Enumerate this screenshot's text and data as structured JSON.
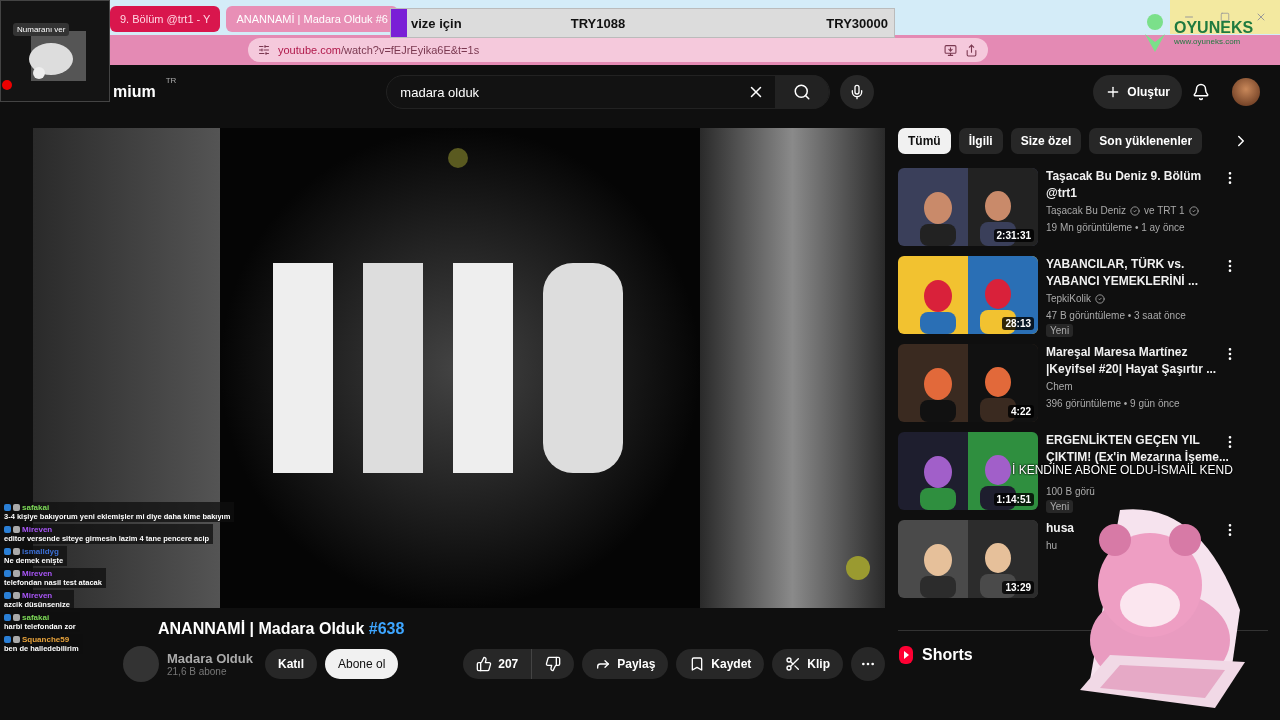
{
  "browser": {
    "tabs": [
      {
        "title": "9. Bölüm @trt1 - Y",
        "selected": false
      },
      {
        "title": "ANANNAMİ | Madara Olduk #6",
        "selected": true
      }
    ],
    "url_domain": "youtube.com",
    "url_path": "/watch?v=fEJrEyika6E&t=1s"
  },
  "header": {
    "logo_text": "mium",
    "region": "TR",
    "search": "madara olduk",
    "create": "Oluştur"
  },
  "video": {
    "title": "ANANNAMİ | Madara Olduk",
    "hashtag": "#638",
    "channel": "Madara Olduk",
    "subscribers": "21,6 B abone",
    "join": "Katıl",
    "subscribe": "Abone ol",
    "likes": "207",
    "share": "Paylaş",
    "save": "Kaydet",
    "clip": "Klip"
  },
  "chips": [
    {
      "label": "Tümü",
      "selected": true
    },
    {
      "label": "İlgili",
      "selected": false
    },
    {
      "label": "Size özel",
      "selected": false
    },
    {
      "label": "Son yüklenenler",
      "selected": false
    }
  ],
  "related": [
    {
      "title": [
        "Taşacak Bu Deniz 9. Bölüm",
        "@trt1"
      ],
      "channels": [
        {
          "name": "Taşacak Bu Deniz",
          "verified": true
        },
        {
          "name": "ve TRT 1",
          "verified": true
        }
      ],
      "meta": "19 Mn görüntüleme • 1 ay önce",
      "duration": "2:31:31"
    },
    {
      "title": [
        "YABANCILAR, TÜRK vs.",
        "YABANCI YEMEKLERİNİ ..."
      ],
      "channels": [
        {
          "name": "TepkiKolik",
          "verified": true
        }
      ],
      "meta": "47 B görüntüleme • 3 saat önce",
      "duration": "28:13",
      "badge": "Yeni"
    },
    {
      "title": [
        "Mareşal Maresa Martínez",
        "|Keyifsel #20| Hayat Şaşırtır ..."
      ],
      "channels": [
        {
          "name": "Chem",
          "verified": false
        }
      ],
      "meta": "396 görüntüleme • 9 gün önce",
      "duration": "4:22"
    },
    {
      "title": [
        "ERGENLİKTEN GEÇEN YIL",
        "ÇIKTIM! (Ex'in Mezarına İşeme..."
      ],
      "meta": "100 B görü",
      "duration": "1:14:51",
      "badge": "Yeni"
    },
    {
      "title": [
        "husa"
      ],
      "channels": [
        {
          "name": "hu",
          "verified": false
        }
      ],
      "duration": "13:29"
    }
  ],
  "shorts": "Shorts",
  "overlays": {
    "webcam_label": "Numaranı ver",
    "donation": {
      "label": "vize için",
      "current": "TRY1088",
      "goal": "TRY30000"
    },
    "ticker": "İ KENDİNE ABONE OLDU-İSMAİL KEND",
    "sponsor": {
      "name": "OYUNEKS",
      "site": "www.oyuneks.com"
    }
  },
  "chat": [
    {
      "user": "safakai",
      "color": "#7cd957",
      "text": "3-4 kişiye bakıyorum yeni eklemişler mi diye daha kime bakıyım"
    },
    {
      "user": "Mireven",
      "color": "#a855f7",
      "text": "editor versende siteye girmesin lazim 4 tane pencere acip"
    },
    {
      "user": "ismalldyg",
      "color": "#3b6fd6",
      "text": "Ne demek enişte"
    },
    {
      "user": "Mireven",
      "color": "#a855f7",
      "text": "telefondan nasil test atacak"
    },
    {
      "user": "Mireven",
      "color": "#a855f7",
      "text": "azcik düsünsenize"
    },
    {
      "user": "safakai",
      "color": "#7cd957",
      "text": "harbi telefondan zor"
    },
    {
      "user": "Squanche59",
      "color": "#e8a33b",
      "text": "ben de halledebilirim"
    }
  ]
}
